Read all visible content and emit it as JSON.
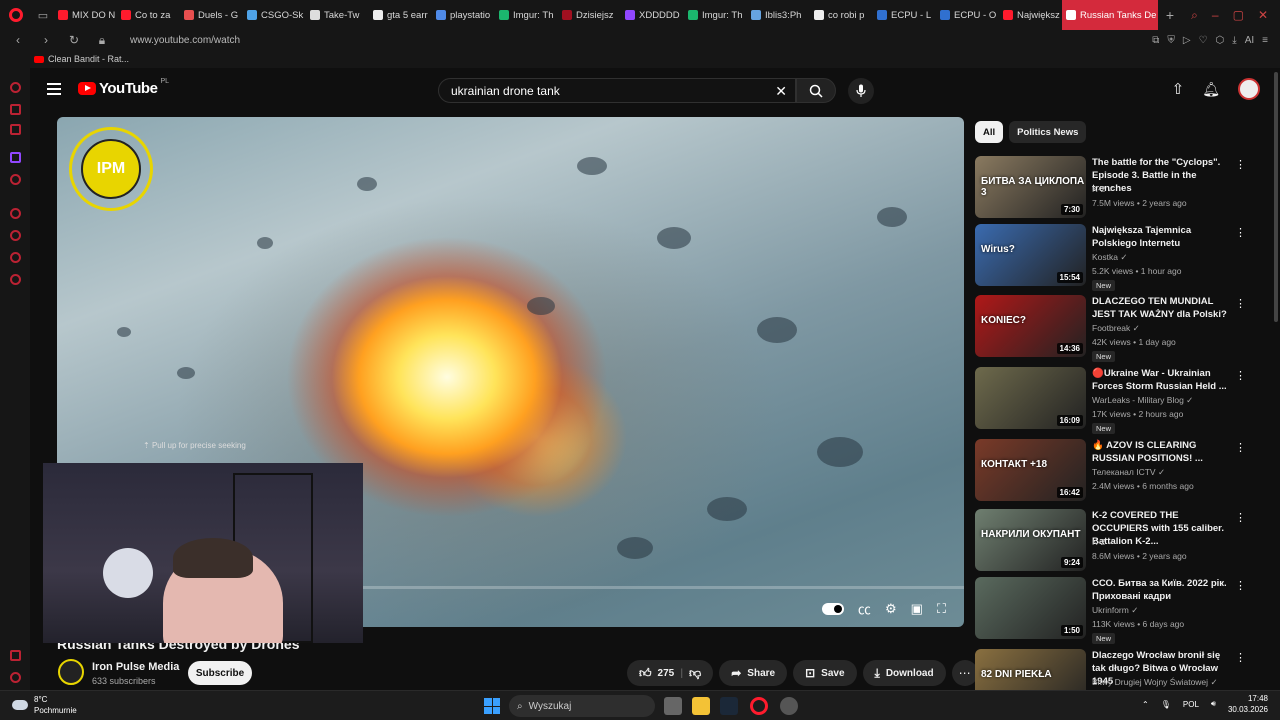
{
  "browser": {
    "tabs": [
      {
        "label": "MIX DO N",
        "color": "#ff1b2d"
      },
      {
        "label": "Co to za",
        "color": "#ff1b2d"
      },
      {
        "label": "Duels - G",
        "color": "#e84f4f"
      },
      {
        "label": "CSGO-Sk",
        "color": "#4fa3e8"
      },
      {
        "label": "Take-Tw",
        "color": "#dddddd"
      },
      {
        "label": "gta 5 earr",
        "color": "#eeeeee"
      },
      {
        "label": "playstatio",
        "color": "#4f8ae8"
      },
      {
        "label": "Imgur: Th",
        "color": "#1bb76e"
      },
      {
        "label": "Dzisiejsz",
        "color": "#a01020"
      },
      {
        "label": "XDDDDD",
        "color": "#9147ff"
      },
      {
        "label": "Imgur: Th",
        "color": "#1bb76e"
      },
      {
        "label": "Iblis3:Ph",
        "color": "#66a3e0"
      },
      {
        "label": "co robi p",
        "color": "#eeeeee"
      },
      {
        "label": "ECPU - L",
        "color": "#3070d0"
      },
      {
        "label": "ECPU - O",
        "color": "#3070d0"
      },
      {
        "label": "Największ",
        "color": "#ff1b2d"
      }
    ],
    "active_tab": "Russian Tanks De",
    "url": "www.youtube.com/watch",
    "bookmark": "Clean Bandit - Rat..."
  },
  "youtube": {
    "logo_text": "YouTube",
    "region": "PL",
    "search_value": "ukrainian drone tank",
    "player": {
      "seek_hint": "Pull up for precise seeking",
      "progress": 0.0,
      "channel_logo_text": "IPM"
    },
    "video": {
      "title": "Russian Tanks Destroyed by Drones",
      "channel": "Iron Pulse Media",
      "subscribers": "633 subscribers",
      "subscribe_label": "Subscribe",
      "likes": "275",
      "share_label": "Share",
      "save_label": "Save",
      "download_label": "Download"
    },
    "chips": [
      "All",
      "Politics News"
    ],
    "recommendations": [
      {
        "title": "The battle for the \"Cyclops\". Episode 3. Battle in the trenches",
        "channel": "K-2",
        "meta": "7.5M views • 2 years ago",
        "duration": "7:30",
        "new": "",
        "thumb": "#8a7a60",
        "thumb_text": "БИТВА ЗА ЦИКЛОПА 3"
      },
      {
        "title": "Największa Tajemnica Polskiego Internetu",
        "channel": "Kostka",
        "meta": "5.2K views • 1 hour ago",
        "duration": "15:54",
        "new": "New",
        "thumb": "#3a6bb0",
        "thumb_text": "Wirus?"
      },
      {
        "title": "DLACZEGO TEN MUNDIAL JEST TAK WAŻNY dla Polski?",
        "channel": "Footbreak",
        "meta": "42K views • 1 day ago",
        "duration": "14:36",
        "new": "New",
        "thumb": "#b01818",
        "thumb_text": "KONIEC?"
      },
      {
        "title": "🔴Ukraine War - Ukrainian Forces Storm Russian Held ...",
        "channel": "WarLeaks - Military Blog",
        "meta": "17K views • 2 hours ago",
        "duration": "16:09",
        "new": "New",
        "thumb": "#6e6a4c",
        "thumb_text": ""
      },
      {
        "title": "🔥 AZOV IS CLEARING RUSSIAN POSITIONS! ...",
        "channel": "Телеканал ICTV",
        "meta": "2.4M views • 6 months ago",
        "duration": "16:42",
        "new": "",
        "thumb": "#7a3a28",
        "thumb_text": "КОНТАКТ +18"
      },
      {
        "title": "K-2 COVERED THE OCCUPIERS with 155 caliber. Battalion K-2...",
        "channel": "K-2",
        "meta": "8.6M views • 2 years ago",
        "duration": "9:24",
        "new": "",
        "thumb": "#6f7f70",
        "thumb_text": "НАКРИЛИ ОКУПАНТ"
      },
      {
        "title": "ССО. Битва за Київ. 2022 рік. Приховані кадри",
        "channel": "Ukrinform",
        "meta": "113K views • 6 days ago",
        "duration": "1:50",
        "new": "New",
        "thumb": "#5a6a5e",
        "thumb_text": ""
      },
      {
        "title": "Dlaczego Wrocław bronił się tak długo? Bitwa o Wrocław 1945",
        "channel": "Bitwy Drugiej Wojny Światowej",
        "meta": "",
        "duration": "",
        "new": "",
        "thumb": "#8a7040",
        "thumb_text": "82 DNI PIEKŁA"
      }
    ]
  },
  "taskbar": {
    "temperature": "8°C",
    "weather": "Pochmurnie",
    "search_placeholder": "Wyszukaj",
    "language": "POL",
    "time": "17:48",
    "date": "30.03.2026"
  }
}
